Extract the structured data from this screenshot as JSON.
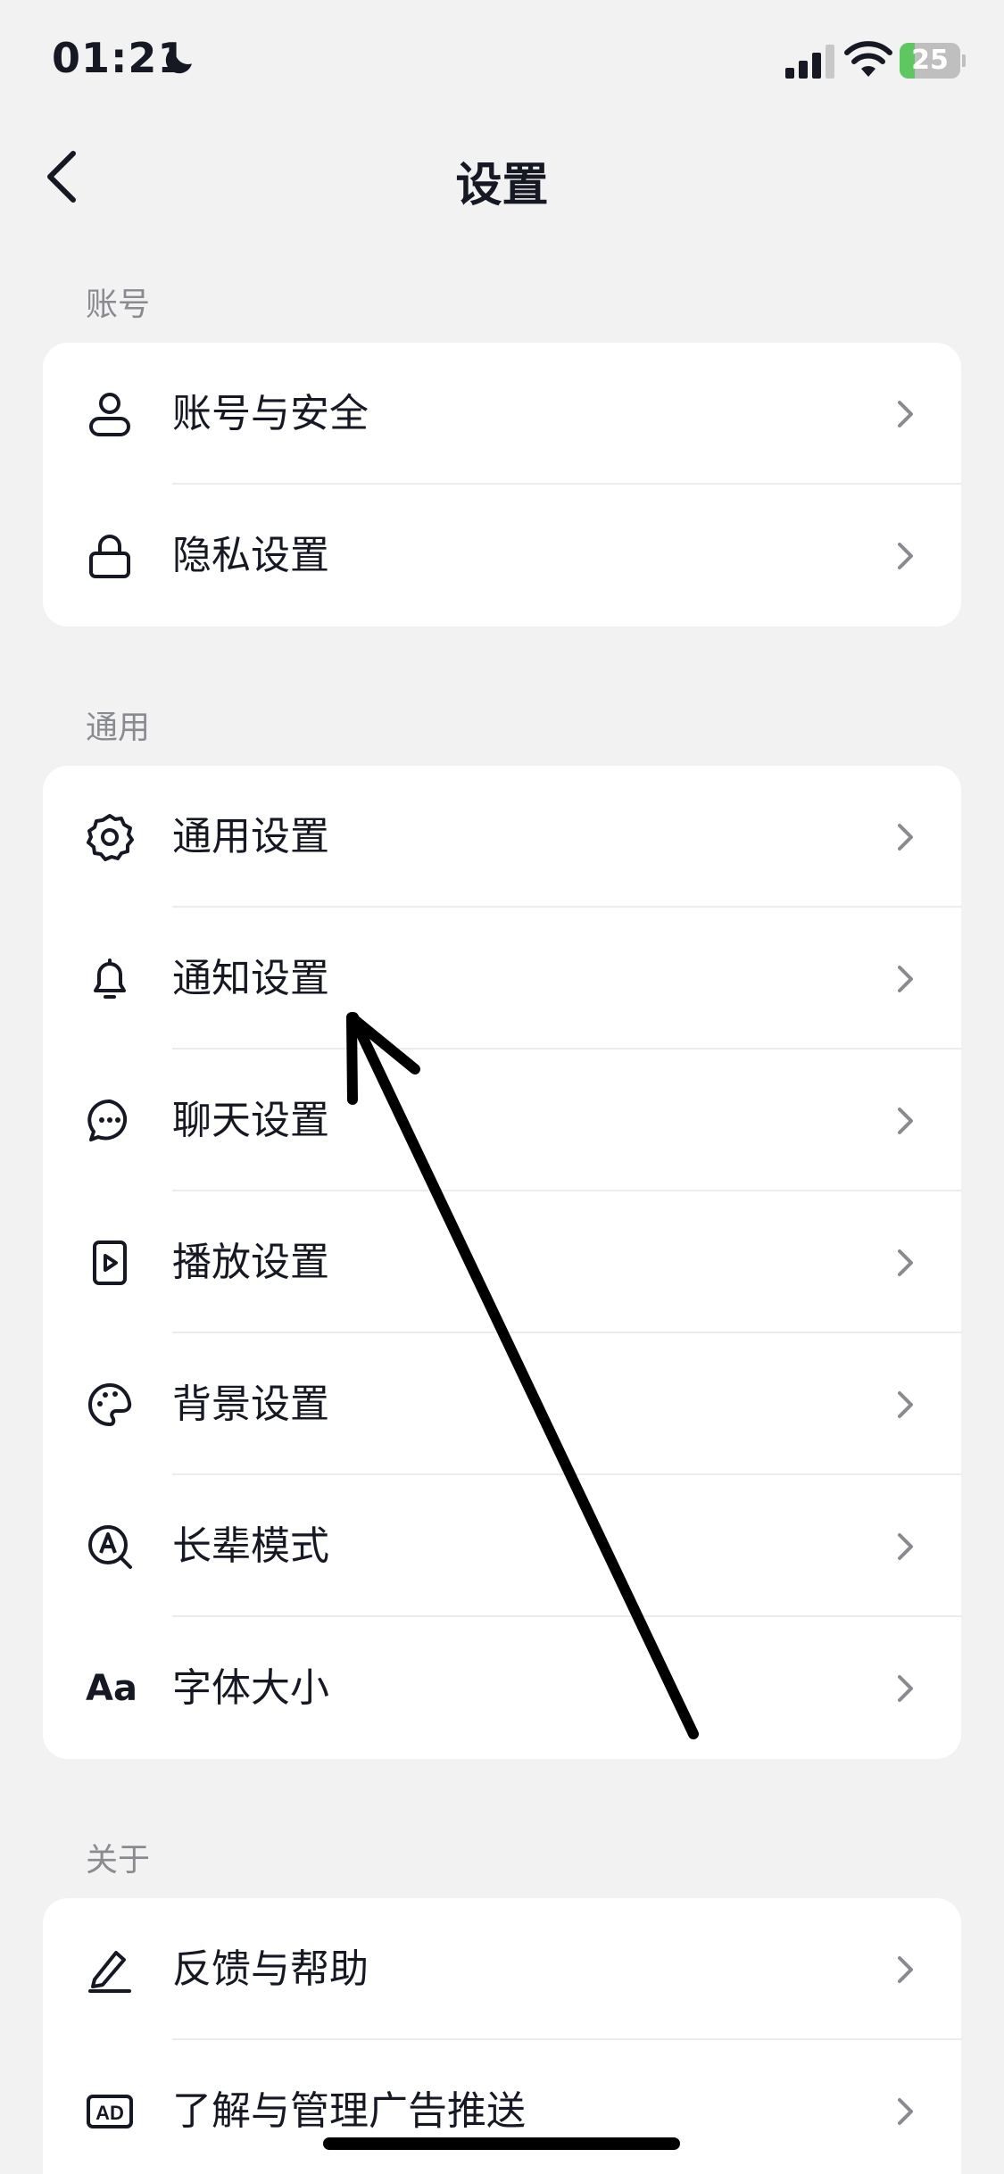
{
  "status_bar": {
    "time": "01:21",
    "battery_level": "25",
    "battery_fraction": 0.25,
    "battery_color": "#5fc760",
    "icons": [
      "moon-icon",
      "signal-icon",
      "wifi-icon",
      "battery-icon"
    ]
  },
  "nav": {
    "title": "设置",
    "back_icon": "chevron-left-icon"
  },
  "sections": {
    "account": {
      "label": "账号",
      "items": [
        {
          "label": "账号与安全",
          "icon": "user-icon"
        },
        {
          "label": "隐私设置",
          "icon": "lock-icon"
        }
      ]
    },
    "general": {
      "label": "通用",
      "items": [
        {
          "label": "通用设置",
          "icon": "gear-icon"
        },
        {
          "label": "通知设置",
          "icon": "bell-icon"
        },
        {
          "label": "聊天设置",
          "icon": "chat-bubble-icon"
        },
        {
          "label": "播放设置",
          "icon": "play-icon"
        },
        {
          "label": "背景设置",
          "icon": "palette-icon"
        },
        {
          "label": "长辈模式",
          "icon": "elder-mode-icon"
        },
        {
          "label": "字体大小",
          "icon": "font-size-icon",
          "glyph": "Aa"
        }
      ]
    },
    "about": {
      "label": "关于",
      "items": [
        {
          "label": "反馈与帮助",
          "icon": "pencil-icon"
        },
        {
          "label": "了解与管理广告推送",
          "icon": "ad-icon",
          "glyph": "AD"
        }
      ]
    }
  },
  "colors": {
    "background": "#f2f2f2",
    "card": "#ffffff",
    "text": "#161823",
    "secondary_text": "#8a8b91",
    "chevron": "#8a8b91",
    "annotation": "#000000"
  }
}
